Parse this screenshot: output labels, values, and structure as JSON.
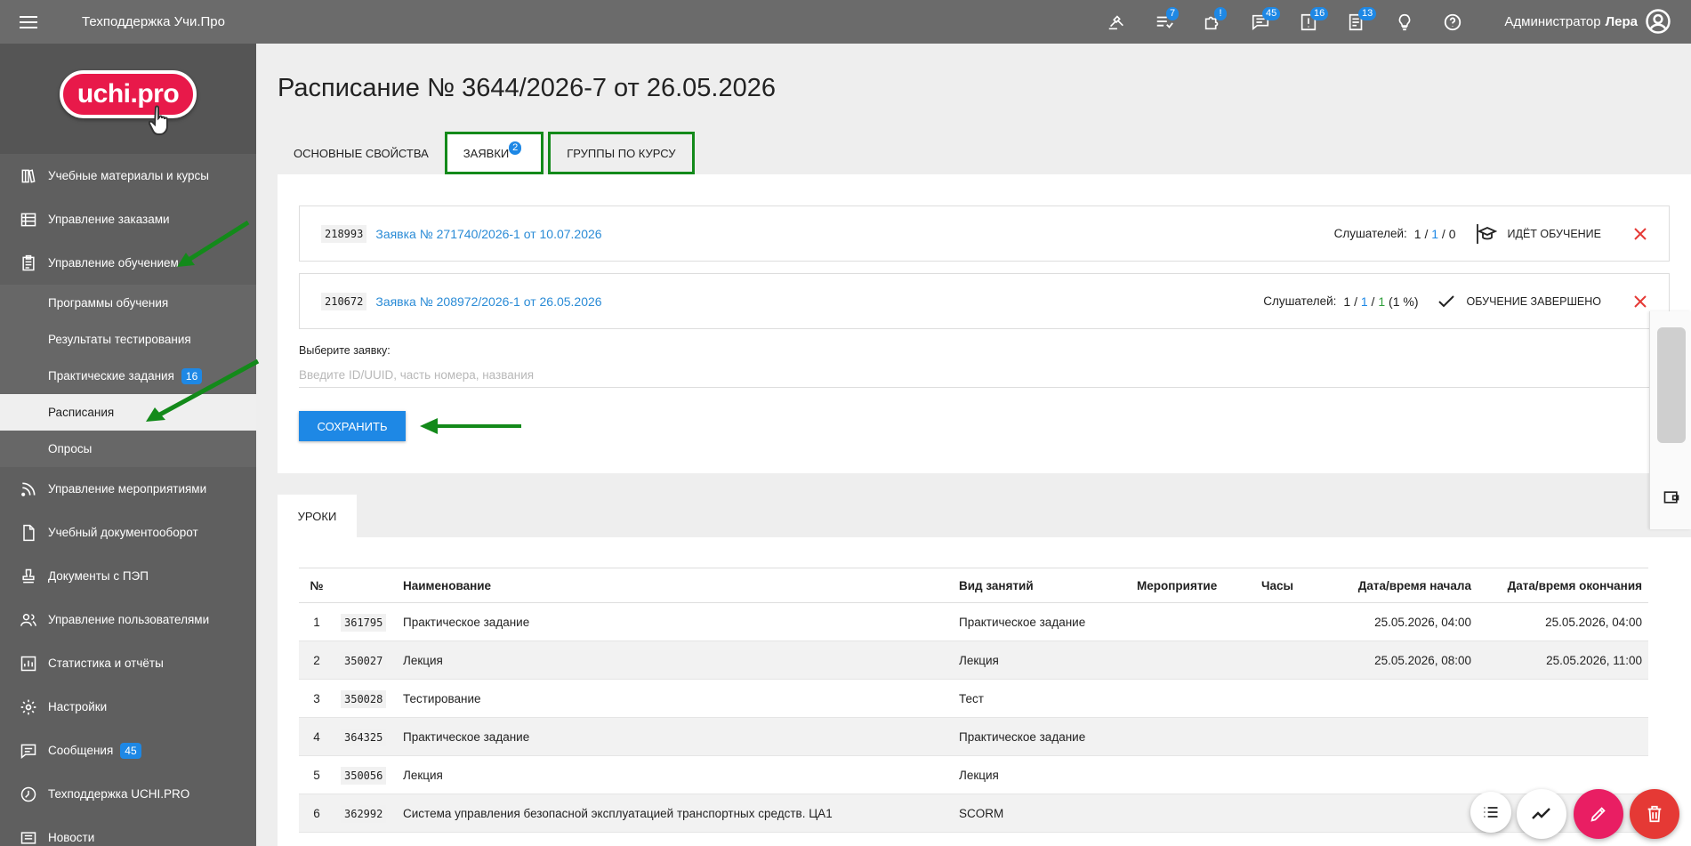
{
  "header": {
    "app_title": "Техподдержка Учи.Про",
    "icons": [
      {
        "name": "hammer-icon",
        "badge": ""
      },
      {
        "name": "list-icon",
        "badge": "7"
      },
      {
        "name": "puzzle-icon",
        "badge": "!"
      },
      {
        "name": "chat-icon",
        "badge": "45"
      },
      {
        "name": "alert-icon",
        "badge": "16"
      },
      {
        "name": "doc-list-icon",
        "badge": "13"
      },
      {
        "name": "lightbulb-icon",
        "badge": ""
      },
      {
        "name": "help-icon",
        "badge": ""
      }
    ],
    "user_role": "Администратор",
    "user_name": "Лера"
  },
  "sidebar": {
    "logo_text": "uchi.pro",
    "items": [
      {
        "label": "Учебные материалы и курсы",
        "icon": "books-icon"
      },
      {
        "label": "Управление заказами",
        "icon": "table-icon"
      },
      {
        "label": "Управление обучением",
        "icon": "clipboard-icon"
      }
    ],
    "sub_items": [
      {
        "label": "Программы обучения",
        "badge": ""
      },
      {
        "label": "Результаты тестирования",
        "badge": ""
      },
      {
        "label": "Практические задания",
        "badge": "16"
      },
      {
        "label": "Расписания",
        "badge": ""
      },
      {
        "label": "Опросы",
        "badge": ""
      }
    ],
    "items_after": [
      {
        "label": "Управление мероприятиями",
        "icon": "rss-icon"
      },
      {
        "label": "Учебный документооборот",
        "icon": "document-icon"
      },
      {
        "label": "Документы с ПЭП",
        "icon": "stamp-icon"
      },
      {
        "label": "Управление пользователями",
        "icon": "users-icon"
      },
      {
        "label": "Статистика и отчёты",
        "icon": "chart-icon"
      },
      {
        "label": "Настройки",
        "icon": "gear-icon"
      },
      {
        "label": "Сообщения",
        "icon": "message-icon",
        "badge": "45"
      },
      {
        "label": "Техподдержка UCHI.PRO",
        "icon": "support-icon"
      },
      {
        "label": "Новости",
        "icon": "news-icon"
      }
    ]
  },
  "page": {
    "title": "Расписание № 3644/2026-7 от 26.05.2026",
    "tabs": [
      {
        "label": "ОСНОВНЫЕ СВОЙСТВА"
      },
      {
        "label": "ЗАЯВКИ",
        "badge": "2"
      },
      {
        "label": "ГРУППЫ ПО КУРСУ"
      }
    ],
    "requests": [
      {
        "id": "218993",
        "title": "Заявка № 271740/2026-1 от 10.07.2026",
        "listeners_label": "Слушателей:",
        "c1": "1",
        "c2": "1",
        "c3": "0",
        "percent": "",
        "status": "ИДЁТ ОБУЧЕНИЕ"
      },
      {
        "id": "210672",
        "title": "Заявка № 208972/2026-1 от 26.05.2026",
        "listeners_label": "Слушателей:",
        "c1": "1",
        "c2": "1",
        "c3": "1",
        "percent": "(1 %)",
        "status": "ОБУЧЕНИЕ ЗАВЕРШЕНО"
      }
    ],
    "select_label": "Выберите заявку:",
    "select_placeholder": "Введите ID/UUID, часть номера, названия",
    "save_label": "СОХРАНИТЬ",
    "lessons_tab": "УРОКИ",
    "table": {
      "headers": [
        "№",
        "",
        "Наименование",
        "Вид занятий",
        "Мероприятие",
        "Часы",
        "Дата/время начала",
        "Дата/время окончания"
      ],
      "rows": [
        [
          "1",
          "361795",
          "Практическое задание",
          "Практическое задание",
          "",
          "",
          "25.05.2026, 04:00",
          "25.05.2026, 04:00"
        ],
        [
          "2",
          "350027",
          "Лекция",
          "Лекция",
          "",
          "",
          "25.05.2026, 08:00",
          "25.05.2026, 11:00"
        ],
        [
          "3",
          "350028",
          "Тестирование",
          "Тест",
          "",
          "",
          "",
          ""
        ],
        [
          "4",
          "364325",
          "Практическое задание",
          "Практическое задание",
          "",
          "",
          "",
          ""
        ],
        [
          "5",
          "350056",
          "Лекция",
          "Лекция",
          "",
          "",
          "",
          ""
        ],
        [
          "6",
          "362992",
          "Система управления безопасной эксплуатацией транспортных средств. ЦА1",
          "SCORM",
          "",
          "",
          "",
          ""
        ]
      ]
    }
  },
  "colors": {
    "accent": "#1e88e5",
    "highlight": "#138a1a",
    "danger": "#e53935",
    "fab_pink": "#e91e63",
    "fab_red": "#e53935"
  }
}
